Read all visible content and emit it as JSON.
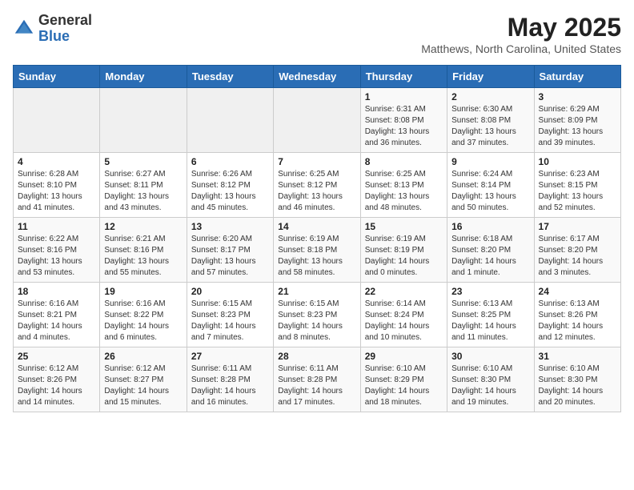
{
  "header": {
    "logo_general": "General",
    "logo_blue": "Blue",
    "month_title": "May 2025",
    "location": "Matthews, North Carolina, United States"
  },
  "weekdays": [
    "Sunday",
    "Monday",
    "Tuesday",
    "Wednesday",
    "Thursday",
    "Friday",
    "Saturday"
  ],
  "weeks": [
    [
      {
        "day": "",
        "sunrise": "",
        "sunset": "",
        "daylight": ""
      },
      {
        "day": "",
        "sunrise": "",
        "sunset": "",
        "daylight": ""
      },
      {
        "day": "",
        "sunrise": "",
        "sunset": "",
        "daylight": ""
      },
      {
        "day": "",
        "sunrise": "",
        "sunset": "",
        "daylight": ""
      },
      {
        "day": "1",
        "sunrise": "Sunrise: 6:31 AM",
        "sunset": "Sunset: 8:08 PM",
        "daylight": "Daylight: 13 hours and 36 minutes."
      },
      {
        "day": "2",
        "sunrise": "Sunrise: 6:30 AM",
        "sunset": "Sunset: 8:08 PM",
        "daylight": "Daylight: 13 hours and 37 minutes."
      },
      {
        "day": "3",
        "sunrise": "Sunrise: 6:29 AM",
        "sunset": "Sunset: 8:09 PM",
        "daylight": "Daylight: 13 hours and 39 minutes."
      }
    ],
    [
      {
        "day": "4",
        "sunrise": "Sunrise: 6:28 AM",
        "sunset": "Sunset: 8:10 PM",
        "daylight": "Daylight: 13 hours and 41 minutes."
      },
      {
        "day": "5",
        "sunrise": "Sunrise: 6:27 AM",
        "sunset": "Sunset: 8:11 PM",
        "daylight": "Daylight: 13 hours and 43 minutes."
      },
      {
        "day": "6",
        "sunrise": "Sunrise: 6:26 AM",
        "sunset": "Sunset: 8:12 PM",
        "daylight": "Daylight: 13 hours and 45 minutes."
      },
      {
        "day": "7",
        "sunrise": "Sunrise: 6:25 AM",
        "sunset": "Sunset: 8:12 PM",
        "daylight": "Daylight: 13 hours and 46 minutes."
      },
      {
        "day": "8",
        "sunrise": "Sunrise: 6:25 AM",
        "sunset": "Sunset: 8:13 PM",
        "daylight": "Daylight: 13 hours and 48 minutes."
      },
      {
        "day": "9",
        "sunrise": "Sunrise: 6:24 AM",
        "sunset": "Sunset: 8:14 PM",
        "daylight": "Daylight: 13 hours and 50 minutes."
      },
      {
        "day": "10",
        "sunrise": "Sunrise: 6:23 AM",
        "sunset": "Sunset: 8:15 PM",
        "daylight": "Daylight: 13 hours and 52 minutes."
      }
    ],
    [
      {
        "day": "11",
        "sunrise": "Sunrise: 6:22 AM",
        "sunset": "Sunset: 8:16 PM",
        "daylight": "Daylight: 13 hours and 53 minutes."
      },
      {
        "day": "12",
        "sunrise": "Sunrise: 6:21 AM",
        "sunset": "Sunset: 8:16 PM",
        "daylight": "Daylight: 13 hours and 55 minutes."
      },
      {
        "day": "13",
        "sunrise": "Sunrise: 6:20 AM",
        "sunset": "Sunset: 8:17 PM",
        "daylight": "Daylight: 13 hours and 57 minutes."
      },
      {
        "day": "14",
        "sunrise": "Sunrise: 6:19 AM",
        "sunset": "Sunset: 8:18 PM",
        "daylight": "Daylight: 13 hours and 58 minutes."
      },
      {
        "day": "15",
        "sunrise": "Sunrise: 6:19 AM",
        "sunset": "Sunset: 8:19 PM",
        "daylight": "Daylight: 14 hours and 0 minutes."
      },
      {
        "day": "16",
        "sunrise": "Sunrise: 6:18 AM",
        "sunset": "Sunset: 8:20 PM",
        "daylight": "Daylight: 14 hours and 1 minute."
      },
      {
        "day": "17",
        "sunrise": "Sunrise: 6:17 AM",
        "sunset": "Sunset: 8:20 PM",
        "daylight": "Daylight: 14 hours and 3 minutes."
      }
    ],
    [
      {
        "day": "18",
        "sunrise": "Sunrise: 6:16 AM",
        "sunset": "Sunset: 8:21 PM",
        "daylight": "Daylight: 14 hours and 4 minutes."
      },
      {
        "day": "19",
        "sunrise": "Sunrise: 6:16 AM",
        "sunset": "Sunset: 8:22 PM",
        "daylight": "Daylight: 14 hours and 6 minutes."
      },
      {
        "day": "20",
        "sunrise": "Sunrise: 6:15 AM",
        "sunset": "Sunset: 8:23 PM",
        "daylight": "Daylight: 14 hours and 7 minutes."
      },
      {
        "day": "21",
        "sunrise": "Sunrise: 6:15 AM",
        "sunset": "Sunset: 8:23 PM",
        "daylight": "Daylight: 14 hours and 8 minutes."
      },
      {
        "day": "22",
        "sunrise": "Sunrise: 6:14 AM",
        "sunset": "Sunset: 8:24 PM",
        "daylight": "Daylight: 14 hours and 10 minutes."
      },
      {
        "day": "23",
        "sunrise": "Sunrise: 6:13 AM",
        "sunset": "Sunset: 8:25 PM",
        "daylight": "Daylight: 14 hours and 11 minutes."
      },
      {
        "day": "24",
        "sunrise": "Sunrise: 6:13 AM",
        "sunset": "Sunset: 8:26 PM",
        "daylight": "Daylight: 14 hours and 12 minutes."
      }
    ],
    [
      {
        "day": "25",
        "sunrise": "Sunrise: 6:12 AM",
        "sunset": "Sunset: 8:26 PM",
        "daylight": "Daylight: 14 hours and 14 minutes."
      },
      {
        "day": "26",
        "sunrise": "Sunrise: 6:12 AM",
        "sunset": "Sunset: 8:27 PM",
        "daylight": "Daylight: 14 hours and 15 minutes."
      },
      {
        "day": "27",
        "sunrise": "Sunrise: 6:11 AM",
        "sunset": "Sunset: 8:28 PM",
        "daylight": "Daylight: 14 hours and 16 minutes."
      },
      {
        "day": "28",
        "sunrise": "Sunrise: 6:11 AM",
        "sunset": "Sunset: 8:28 PM",
        "daylight": "Daylight: 14 hours and 17 minutes."
      },
      {
        "day": "29",
        "sunrise": "Sunrise: 6:10 AM",
        "sunset": "Sunset: 8:29 PM",
        "daylight": "Daylight: 14 hours and 18 minutes."
      },
      {
        "day": "30",
        "sunrise": "Sunrise: 6:10 AM",
        "sunset": "Sunset: 8:30 PM",
        "daylight": "Daylight: 14 hours and 19 minutes."
      },
      {
        "day": "31",
        "sunrise": "Sunrise: 6:10 AM",
        "sunset": "Sunset: 8:30 PM",
        "daylight": "Daylight: 14 hours and 20 minutes."
      }
    ]
  ]
}
